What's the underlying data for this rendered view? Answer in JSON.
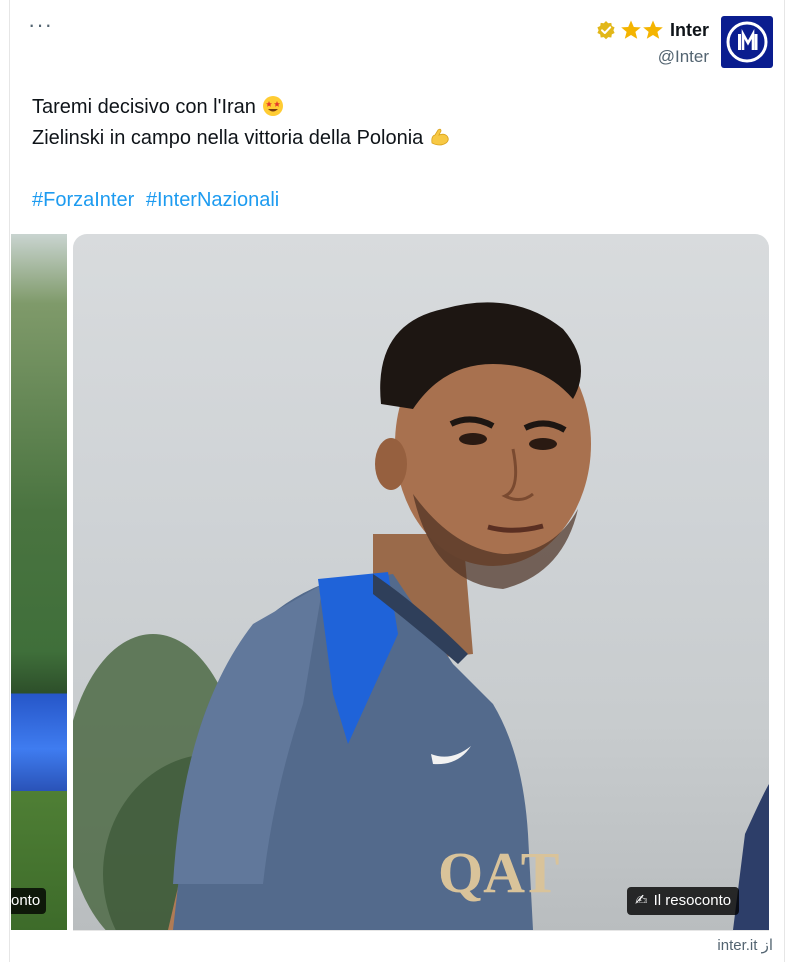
{
  "tweet": {
    "more_label": "···",
    "author": {
      "display_name": "Inter",
      "handle": "@Inter",
      "avatar_icon": "inter-logo-icon",
      "badge_icon": "verified-gold-badge-icon",
      "star_icons": [
        "star-icon",
        "star-icon"
      ]
    },
    "text_lines": [
      "Taremi decisivo con l'Iran",
      "Zielinski in campo nella vittoria della Polonia"
    ],
    "emojis": [
      "star-struck-emoji",
      "flexed-biceps-emoji"
    ],
    "hashtags": [
      "#ForzaInter",
      "#InterNazionali"
    ],
    "media": {
      "prev_label": "onto",
      "caption": "Il resoconto",
      "caption_icon": "writing-hand-icon",
      "shirt_text": "QAT"
    },
    "source": "inter.it از"
  },
  "colors": {
    "link": "#1d9bf0",
    "avatar_bg": "#0a1d8f",
    "badge_gold": "#e2b719",
    "star": "#f4b400",
    "text_secondary": "#536471"
  }
}
